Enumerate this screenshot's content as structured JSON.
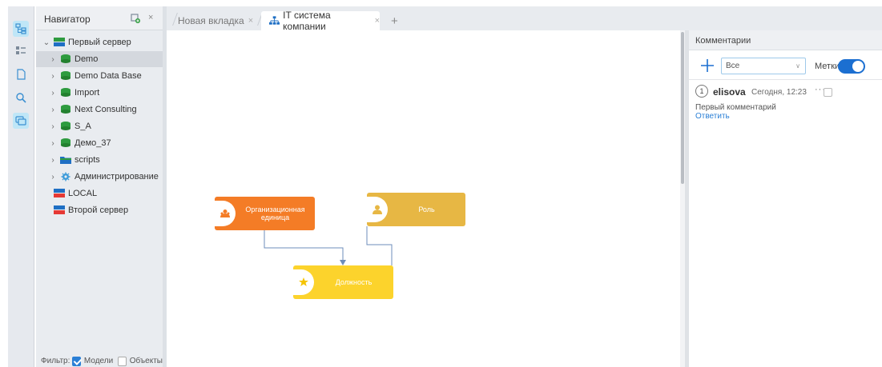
{
  "navigator": {
    "title": "Навигатор",
    "close": "×",
    "tree": [
      {
        "label": "Первый сервер",
        "icon": "server-icon",
        "expanded": true
      },
      {
        "label": "Demo",
        "icon": "database-icon",
        "selected": true
      },
      {
        "label": "Demo Data Base",
        "icon": "database-icon"
      },
      {
        "label": "Import",
        "icon": "database-icon"
      },
      {
        "label": "Next Consulting",
        "icon": "database-icon"
      },
      {
        "label": "S_A",
        "icon": "database-icon"
      },
      {
        "label": "Демо_37",
        "icon": "database-icon"
      },
      {
        "label": "scripts",
        "icon": "folder-icon"
      },
      {
        "label": "Администрирование",
        "icon": "gear-icon"
      },
      {
        "label": "LOCAL",
        "icon": "server-icon"
      },
      {
        "label": "Второй сервер",
        "icon": "server-icon"
      }
    ],
    "filter": {
      "label": "Фильтр:",
      "models": "Модели",
      "objects": "Объекты",
      "models_checked": true,
      "objects_checked": false
    }
  },
  "tabs": [
    {
      "label": "Новая вкладка",
      "close": "×"
    },
    {
      "label": "IT система компании",
      "close": "×",
      "active": true
    }
  ],
  "tab_plus": "+",
  "nodes": {
    "org": {
      "label": "Организационная единица",
      "color": "#f47c26"
    },
    "role": {
      "label": "Роль",
      "color": "#e7b744"
    },
    "position": {
      "label": "Должность",
      "color": "#fcd32c"
    }
  },
  "comments": {
    "title": "Комментарии",
    "filter_value": "Все",
    "tags_label": "Метки",
    "tags_on": true,
    "item": {
      "number": "1",
      "author": "elisova",
      "date": "Сегодня, 12:23",
      "more": "···",
      "text": "Первый комментарий",
      "reply": "Ответить"
    }
  },
  "colors": {
    "accent": "#1b6fd1",
    "toolbar_bg": "#e6e9ee",
    "db_icon": "#2e9b3f"
  }
}
